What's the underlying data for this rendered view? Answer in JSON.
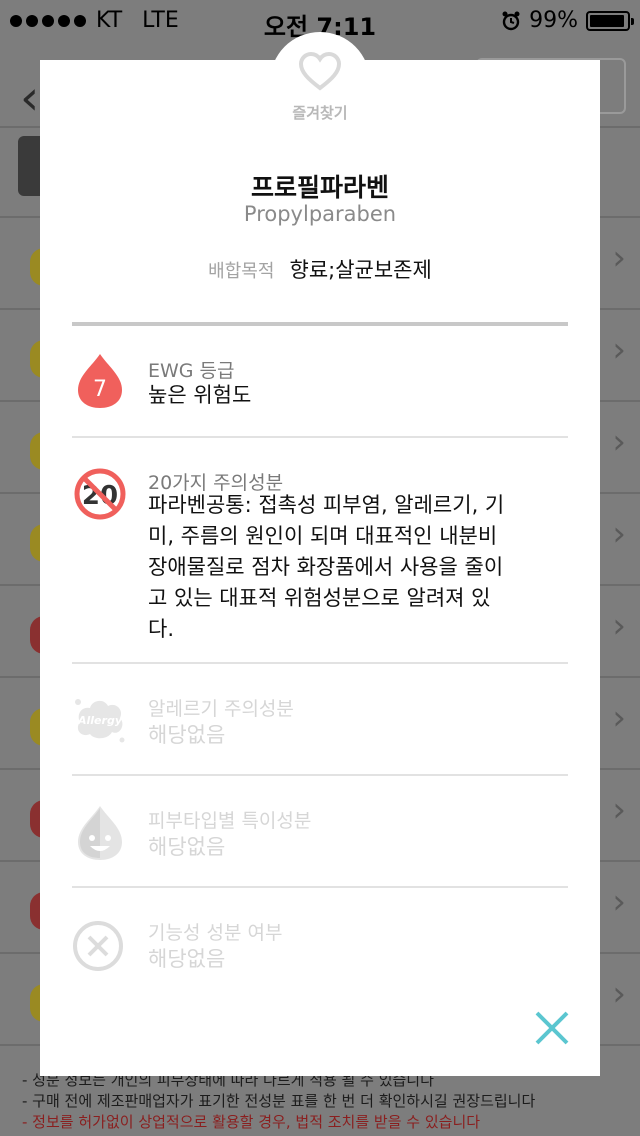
{
  "status_bar": {
    "carrier": "KT",
    "network": "LTE",
    "time": "오전 7:11",
    "battery": "99%"
  },
  "background": {
    "notes": [
      "- 성분 정보는 개인의 피부상태에 따라 다르게 적용 될 수 있습니다",
      "- 구매 전에 제조판매업자가 표기한 전성분 표를 한 번 더 확인하시길 권장드립니다",
      "- 정보를 허가없이 상업적으로 활용할 경우, 법적 조치를 받을 수 있습니다"
    ]
  },
  "modal": {
    "favorite_label": "즐겨찾기",
    "name_ko": "프로필파라벤",
    "name_en": "Propylparaben",
    "purpose_label": "배합목적",
    "purpose_value": "향료;살균보존제",
    "ewg": {
      "grade": "7",
      "title": "EWG 등급",
      "value": "높은 위험도",
      "color": "#f0605c"
    },
    "caution20": {
      "badge": "20",
      "title": "20가지 주의성분",
      "lines": [
        "파라벤공통: 접촉성 피부염, 알레르기, 기",
        "미, 주름의 원인이 되며 대표적인 내분비",
        "장애물질로 점차 화장품에서 사용을 줄이",
        "고 있는 대표적 위험성분으로 알려져 있",
        "다."
      ]
    },
    "allergy": {
      "icon_text": "Allergy",
      "title": "알레르기 주의성분",
      "value": "해당없음"
    },
    "skin_type": {
      "title": "피부타입별 특이성분",
      "value": "해당없음"
    },
    "functional": {
      "title": "기능성 성분 여부",
      "value": "해당없음"
    },
    "accent_color": "#5bc6d0"
  }
}
